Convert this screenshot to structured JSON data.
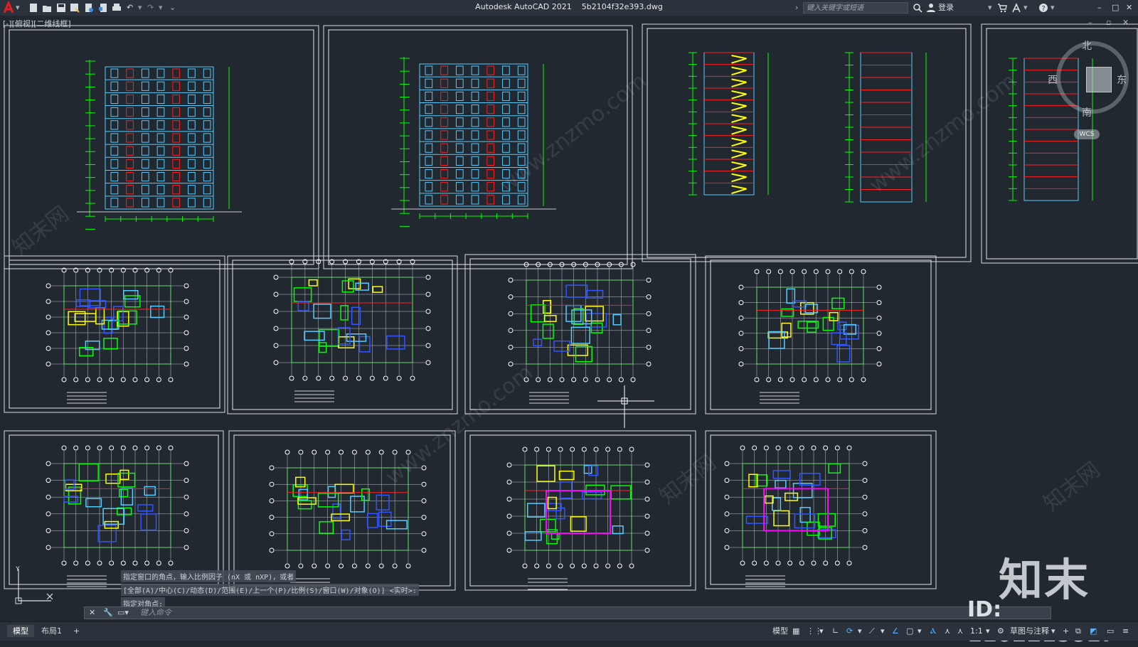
{
  "app": {
    "title": "Autodesk AutoCAD 2021",
    "filename": "5b2104f32e393.dwg",
    "search_placeholder": "键入关键字或短语",
    "login_label": "登录",
    "viewport_label": "[-][俯视][二维线框]"
  },
  "colors": {
    "background": "#212830",
    "chrome": "#2b323b",
    "lines_green": "#00ff00",
    "lines_cyan": "#55ccff",
    "lines_red": "#ff2020",
    "lines_yellow": "#ffff00",
    "lines_blue": "#3355ff",
    "lines_magenta": "#ff00ff"
  },
  "viewcube": {
    "north": "北",
    "south": "南",
    "east": "东",
    "west": "西",
    "wcs": "WCS"
  },
  "command": {
    "history": [
      "指定窗口的角点，输入比例因子 (nX 或 nXP)，或者",
      "[全部(A)/中心(C)/动态(D)/范围(E)/上一个(P)/比例(S)/窗口(W)/对象(O)] <实时>:",
      "指定对角点:"
    ],
    "input_placeholder": "键入命令"
  },
  "status": {
    "tabs": [
      "模型",
      "布局1"
    ],
    "model_label": "模型",
    "scale": "1:1",
    "workspace": "草图与注释"
  },
  "watermark": {
    "brand": "知末",
    "id_text": "ID: 1102215817",
    "url": "www.znzmo.com",
    "cn": "知末网"
  }
}
